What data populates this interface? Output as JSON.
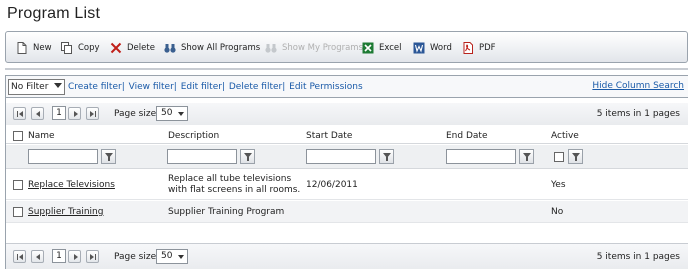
{
  "page": {
    "title": "Program List"
  },
  "toolbar": {
    "new": "New",
    "copy": "Copy",
    "delete": "Delete",
    "show_all": "Show All Programs",
    "show_my": "Show My Programs",
    "excel": "Excel",
    "word": "Word",
    "pdf": "PDF"
  },
  "filterbar": {
    "selected_filter": "No Filter",
    "links": [
      "Create filter",
      "View filter",
      "Edit filter",
      "Delete filter",
      "Edit Permissions"
    ],
    "hide_column_search": "Hide Column Search"
  },
  "pager": {
    "current_page": "1",
    "page_size_label": "Page size:",
    "page_size": "50",
    "info": "5 items in 1 pages"
  },
  "columns": [
    "Name",
    "Description",
    "Start Date",
    "End Date",
    "Active"
  ],
  "rows": [
    {
      "name": "Replace Televisions",
      "description": "Replace all tube televisions with flat screens in all rooms.",
      "start_date": "12/06/2011",
      "end_date": "",
      "active": "Yes"
    },
    {
      "name": "Supplier Training",
      "description": "Supplier Training Program",
      "start_date": "",
      "end_date": "",
      "active": "No"
    }
  ],
  "colors": {
    "link": "#1a5aa8",
    "border": "#9aa3ad",
    "excel": "#1e7b34",
    "word": "#2b5797",
    "delete": "#c0201a"
  },
  "icons": [
    "new-document-icon",
    "copy-icon",
    "delete-x-icon",
    "binoculars-icon",
    "excel-icon",
    "word-icon",
    "pdf-icon",
    "first-page-icon",
    "prev-page-icon",
    "next-page-icon",
    "last-page-icon",
    "filter-funnel-icon"
  ]
}
